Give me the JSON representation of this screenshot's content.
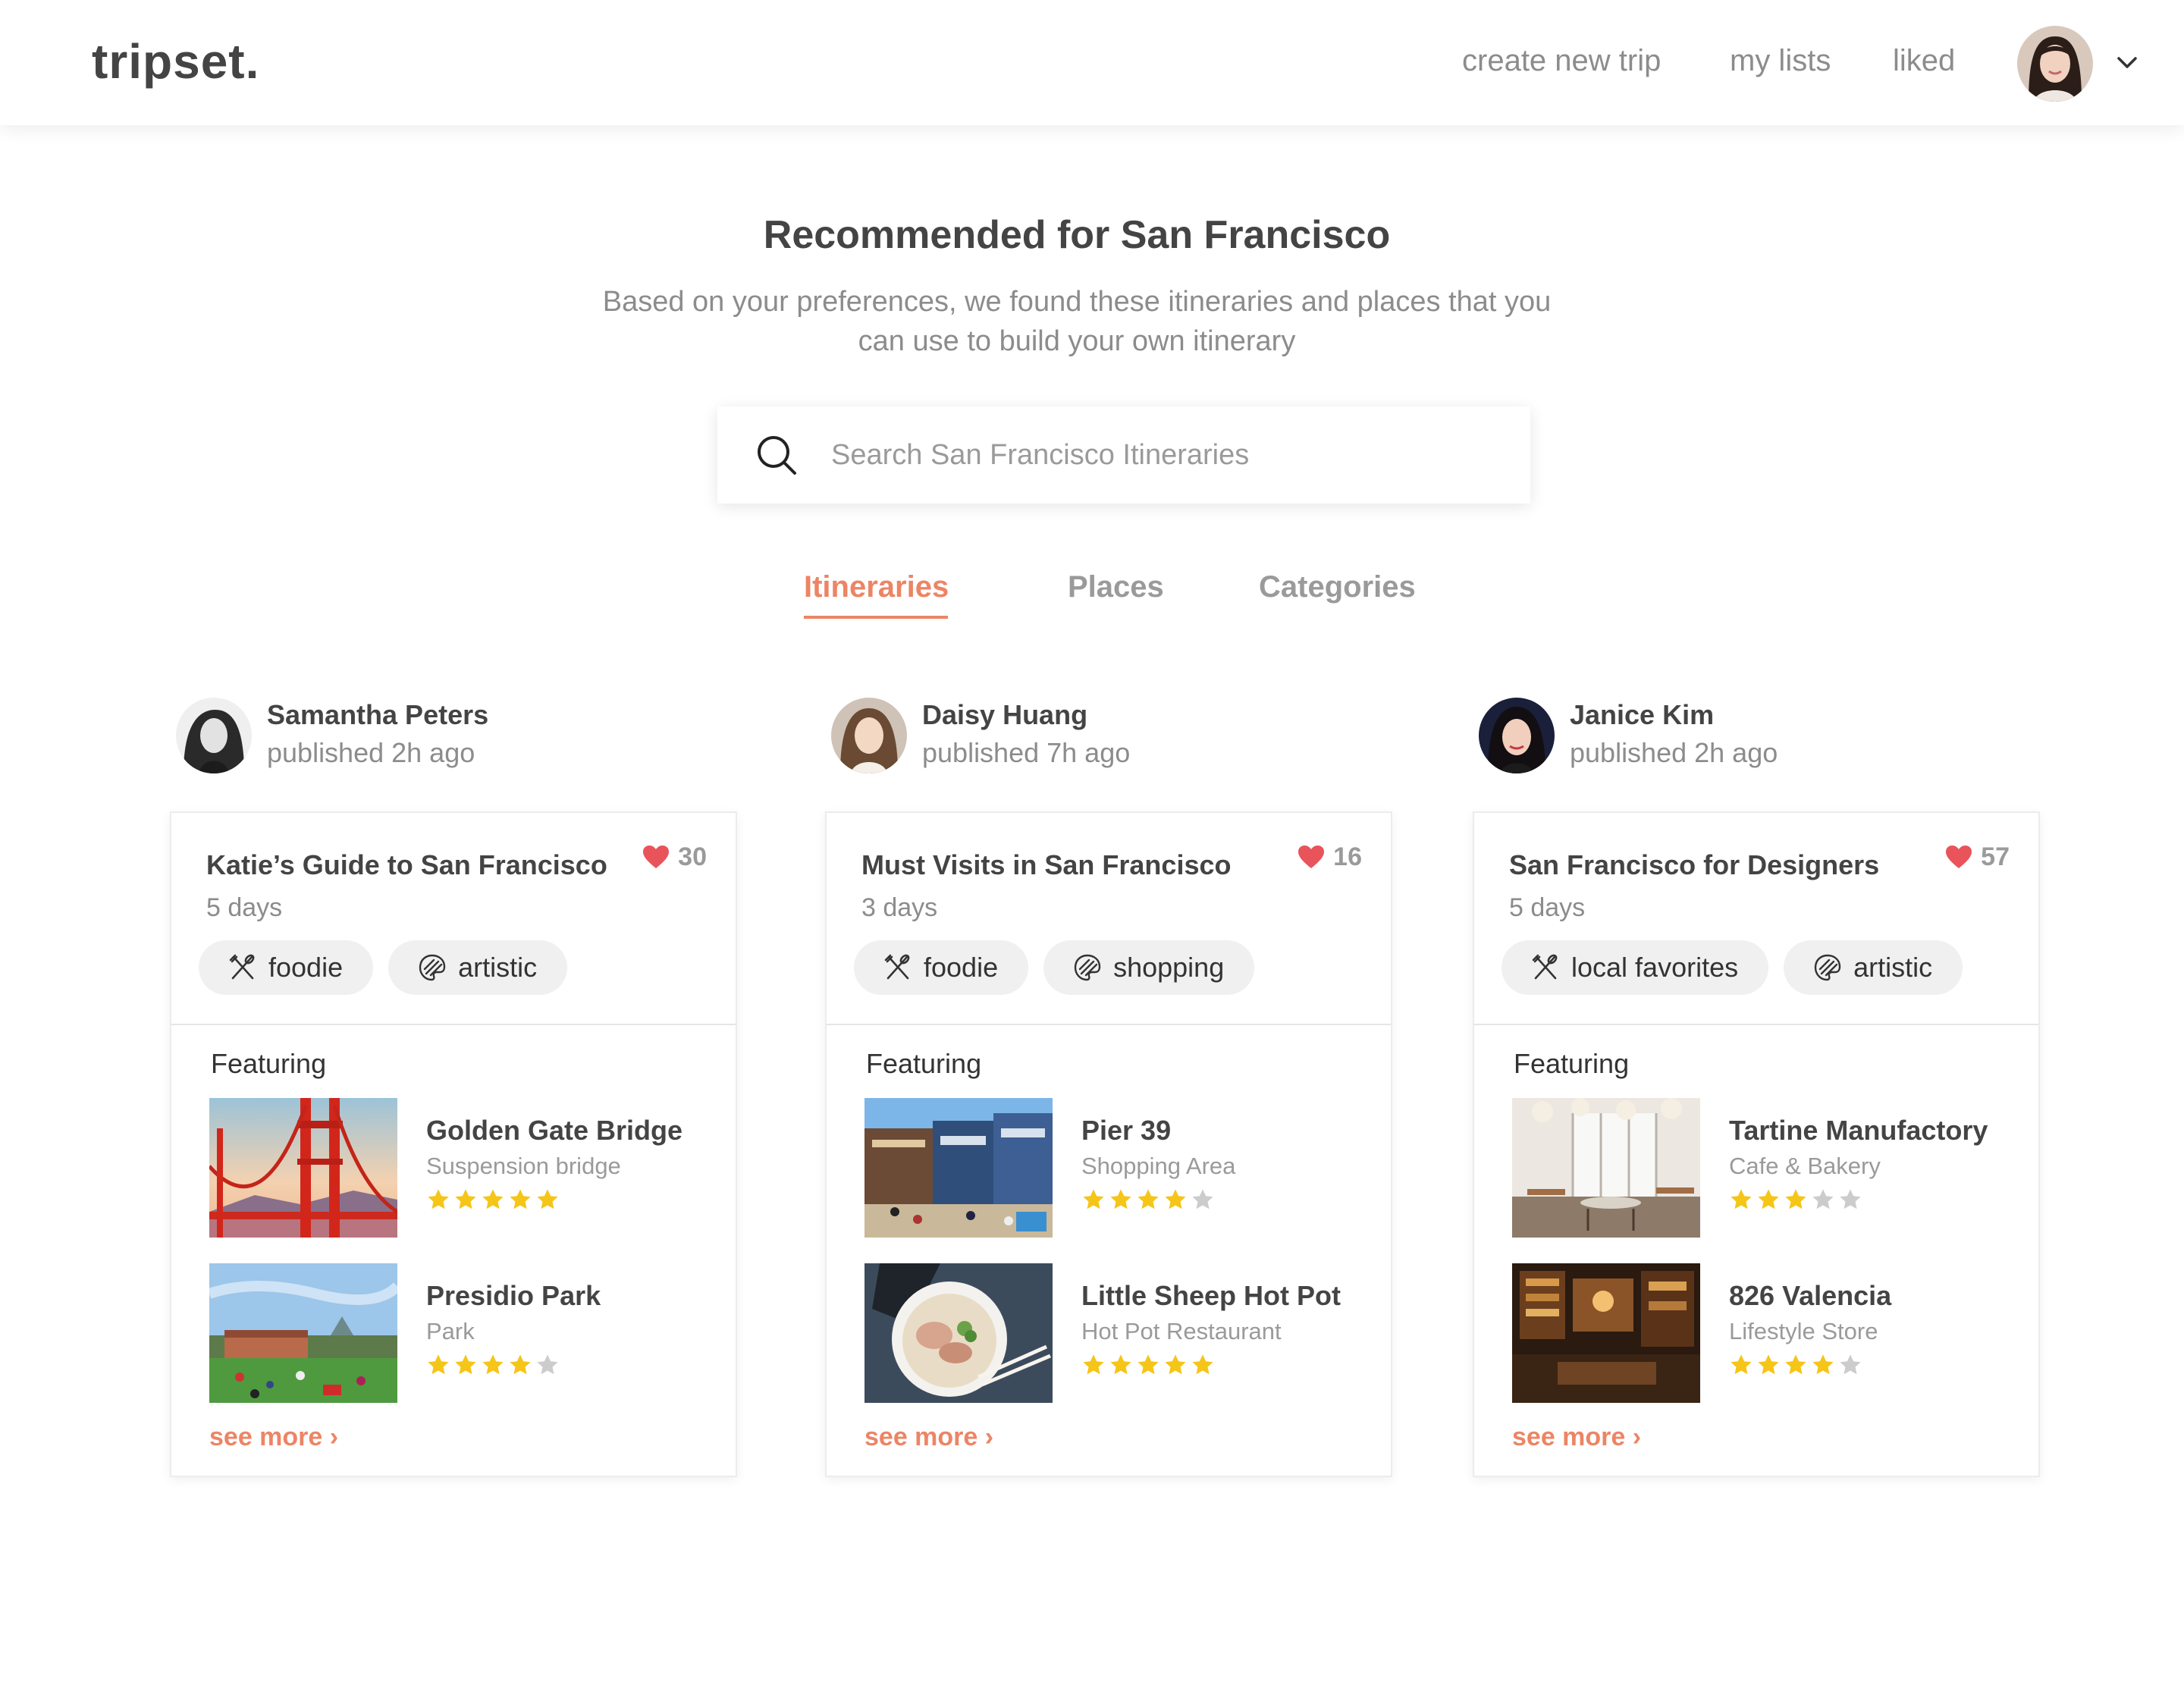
{
  "header": {
    "logo": "tripset.",
    "nav": {
      "create": "create new trip",
      "lists": "my lists",
      "liked": "liked"
    }
  },
  "hero": {
    "title": "Recommended for San Francisco",
    "subtitle": "Based on your preferences, we found these itineraries and places that you can use to build your own itinerary"
  },
  "search": {
    "placeholder": "Search San Francisco Itineraries"
  },
  "tabs": [
    {
      "label": "Itineraries",
      "active": true
    },
    {
      "label": "Places",
      "active": false
    },
    {
      "label": "Categories",
      "active": false
    }
  ],
  "colors": {
    "accent": "#ec8565",
    "star_filled": "#f5c518",
    "star_empty": "#cccccc",
    "heart": "#e8545a"
  },
  "itineraries": [
    {
      "author": {
        "name": "Samantha Peters",
        "time": "published 2h ago"
      },
      "title": "Katie’s Guide to San Francisco",
      "likes": "30",
      "days": "5 days",
      "tags": [
        {
          "icon": "utensils-icon",
          "label": "foodie"
        },
        {
          "icon": "palette-icon",
          "label": "artistic"
        }
      ],
      "featuring": "Featuring",
      "places": [
        {
          "name": "Golden Gate Bridge",
          "type": "Suspension bridge",
          "rating": 5
        },
        {
          "name": "Presidio Park",
          "type": "Park",
          "rating": 4
        }
      ],
      "see_more": "see more ›"
    },
    {
      "author": {
        "name": "Daisy Huang",
        "time": "published 7h ago"
      },
      "title": "Must Visits in San Francisco",
      "likes": "16",
      "days": "3 days",
      "tags": [
        {
          "icon": "utensils-icon",
          "label": "foodie"
        },
        {
          "icon": "palette-icon",
          "label": "shopping"
        }
      ],
      "featuring": "Featuring",
      "places": [
        {
          "name": "Pier 39",
          "type": "Shopping Area",
          "rating": 4
        },
        {
          "name": "Little Sheep Hot Pot",
          "type": "Hot Pot Restaurant",
          "rating": 5
        }
      ],
      "see_more": "see more ›"
    },
    {
      "author": {
        "name": "Janice Kim",
        "time": "published 2h ago"
      },
      "title": "San Francisco for Designers",
      "likes": "57",
      "days": "5 days",
      "tags": [
        {
          "icon": "utensils-icon",
          "label": "local favorites"
        },
        {
          "icon": "palette-icon",
          "label": "artistic"
        }
      ],
      "featuring": "Featuring",
      "places": [
        {
          "name": "Tartine Manufactory",
          "type": "Cafe & Bakery",
          "rating": 3
        },
        {
          "name": "826 Valencia",
          "type": "Lifestyle Store",
          "rating": 4
        }
      ],
      "see_more": "see more ›"
    }
  ]
}
